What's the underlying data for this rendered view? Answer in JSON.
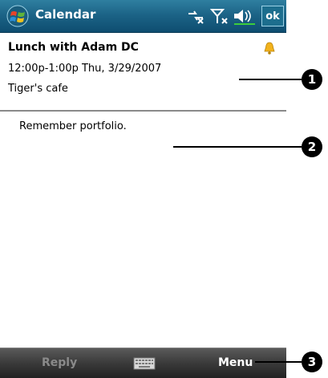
{
  "titlebar": {
    "app_title": "Calendar",
    "ok_label": "ok",
    "icons": [
      "windows-start-icon",
      "connectivity-icon",
      "signal-icon",
      "volume-icon"
    ]
  },
  "appointment": {
    "title": "Lunch with Adam DC",
    "time": "12:00p-1:00p Thu, 3/29/2007",
    "location": "Tiger's cafe",
    "reminder_icon": "bell-icon"
  },
  "notes": "Remember portfolio.",
  "menubar": {
    "left_label": "Reply",
    "right_label": "Menu",
    "center_icon": "keyboard-icon"
  },
  "callouts": [
    "1",
    "2",
    "3"
  ],
  "colors": {
    "titlebar": "#1c6487",
    "menubar": "#3a3a3a",
    "reply_disabled": "#8a8a8a",
    "bell": "#f2b21c"
  }
}
